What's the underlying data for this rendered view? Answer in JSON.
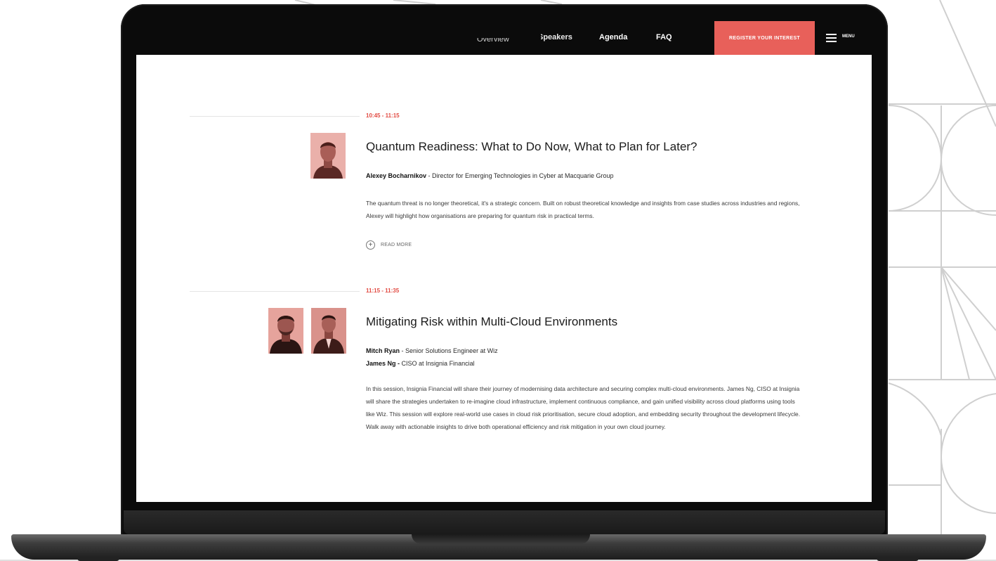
{
  "nav": {
    "items": [
      "Overview",
      "Speakers",
      "Agenda",
      "FAQ"
    ],
    "register_label": "REGISTER YOUR INTEREST",
    "menu_label": "MENU"
  },
  "sessions": [
    {
      "time": "10:45 - 11:15",
      "title": "Quantum Readiness: What to Do Now, What to Plan for Later?",
      "speakers": [
        {
          "name": "Alexey Bocharnikov",
          "role": " - Director for Emerging Technologies in Cyber at Macquarie Group"
        }
      ],
      "description": "The quantum threat is no longer theoretical, it's a strategic concern. Built on robust theoretical knowledge and insights from case studies across industries and regions, Alexey will highlight how organisations are preparing for quantum risk in practical terms.",
      "read_more": "READ MORE"
    },
    {
      "time": "11:15 - 11:35",
      "title": "Mitigating Risk within Multi-Cloud Environments",
      "speakers": [
        {
          "name": "Mitch Ryan",
          "role": " - Senior Solutions Engineer at Wiz"
        },
        {
          "name": "James Ng -",
          "role": " CISO at Insignia Financial"
        }
      ],
      "description": "In this session, Insignia Financial will share their journey of modernising data architecture and securing complex multi-cloud environments. James Ng, CISO at Insignia will share the strategies undertaken to re-imagine cloud infrastructure, implement continuous compliance, and gain unified visibility across cloud platforms using tools like Wiz. This session will explore real-world use cases in cloud risk prioritisation, secure cloud adoption, and embedding security throughout the development lifecycle. Walk away with actionable insights to drive both operational efficiency and risk mitigation in your own cloud journey."
    }
  ],
  "colors": {
    "accent": "#e8605a",
    "time": "#e24b43",
    "photo_tint": "#e9a6a0"
  },
  "icons": [
    "plus-circle-icon",
    "hamburger-icon"
  ]
}
